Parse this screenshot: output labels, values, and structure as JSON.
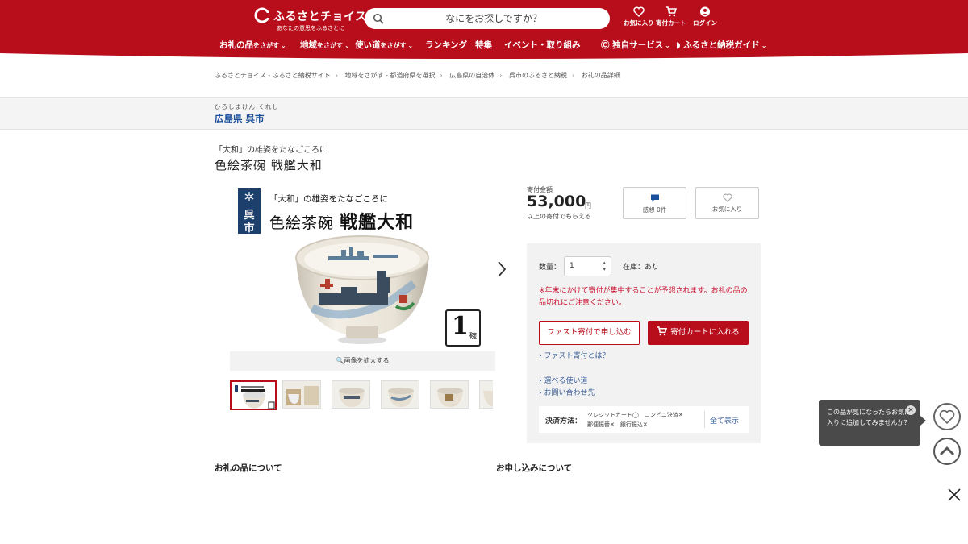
{
  "colors": {
    "brand_red": "#b80d1a",
    "link_blue": "#3a5f9a",
    "area_blue": "#1a4f9c",
    "warn_red": "#c8102e"
  },
  "header": {
    "logo_text": "ふるさとチョイス",
    "logo_sub": "あなたの意思をふるさとに",
    "search_placeholder": "なにをお探しですか？",
    "favorites": "お気に入り",
    "cart": "寄付カート",
    "login": "ログイン"
  },
  "nav": {
    "items": [
      {
        "main": "お礼の品",
        "small": "をさがす"
      },
      {
        "main": "地域",
        "small": "をさがす"
      },
      {
        "main": "使い道",
        "small": "をさがす"
      },
      {
        "main": "ランキング",
        "small": ""
      },
      {
        "main": "特集",
        "small": ""
      },
      {
        "main": "イベント・取り組み",
        "small": ""
      }
    ],
    "service": "独自サービス",
    "guide": "ふるさと納税ガイド"
  },
  "breadcrumb": [
    "ふるさとチョイス - ふるさと納税サイト",
    "地域をさがす - 都道府県を選択",
    "広島県の自治体",
    "呉市のふるさと納税",
    "お礼の品詳細"
  ],
  "area": {
    "kana": "ひろしまけん くれし",
    "name": "広島県 呉市"
  },
  "product": {
    "catch": "「大和」の雄姿をたなごころに",
    "title": "色絵茶碗 戦艦大和",
    "image": {
      "badge_line1": "呉",
      "badge_line2": "市",
      "sub": "「大和」の雄姿をたなごころに",
      "title_a": "色絵茶碗",
      "title_b": "戦艦大和",
      "qty_num": "1",
      "qty_unit": "碗"
    },
    "zoom_label": "🔍画像を拡大する",
    "thumbnail_count": 6
  },
  "price": {
    "label": "寄付金額",
    "amount": "53,000",
    "unit": "円",
    "note": "以上の寄付でもらえる"
  },
  "reviews_button": "感想 0件",
  "favorite_button": "お気に入り",
  "order": {
    "qty_label": "数量：",
    "qty_value": "1",
    "stock": "在庫：あり",
    "warning": "※年末にかけて寄付が集中することが予想されます。お礼の品の品切れにご注意ください。",
    "fast_button": "ファスト寄付で申し込む",
    "cart_button": "寄付カートに入れる",
    "fast_link": "› ファスト寄付とは？",
    "usage_link": "› 選べる使い道",
    "contact_link": "› お問い合わせ先",
    "payment_label": "決済方法：",
    "payment_line1": "クレジットカード◯　コンビニ決済✕",
    "payment_line2": "郵便振替✕　銀行振込✕",
    "payment_all": "全て表示"
  },
  "sections": {
    "about": "お礼の品について",
    "apply": "お申し込みについて"
  },
  "tooltip": {
    "text": "この品が気になったらお気に入りに追加してみませんか？"
  },
  "icons": [
    "logo-icon",
    "search-icon",
    "heart-icon",
    "cart-icon",
    "user-icon",
    "chat-icon",
    "chevron-right-icon",
    "arrow-up-icon",
    "close-icon",
    "snowflake-icon"
  ]
}
